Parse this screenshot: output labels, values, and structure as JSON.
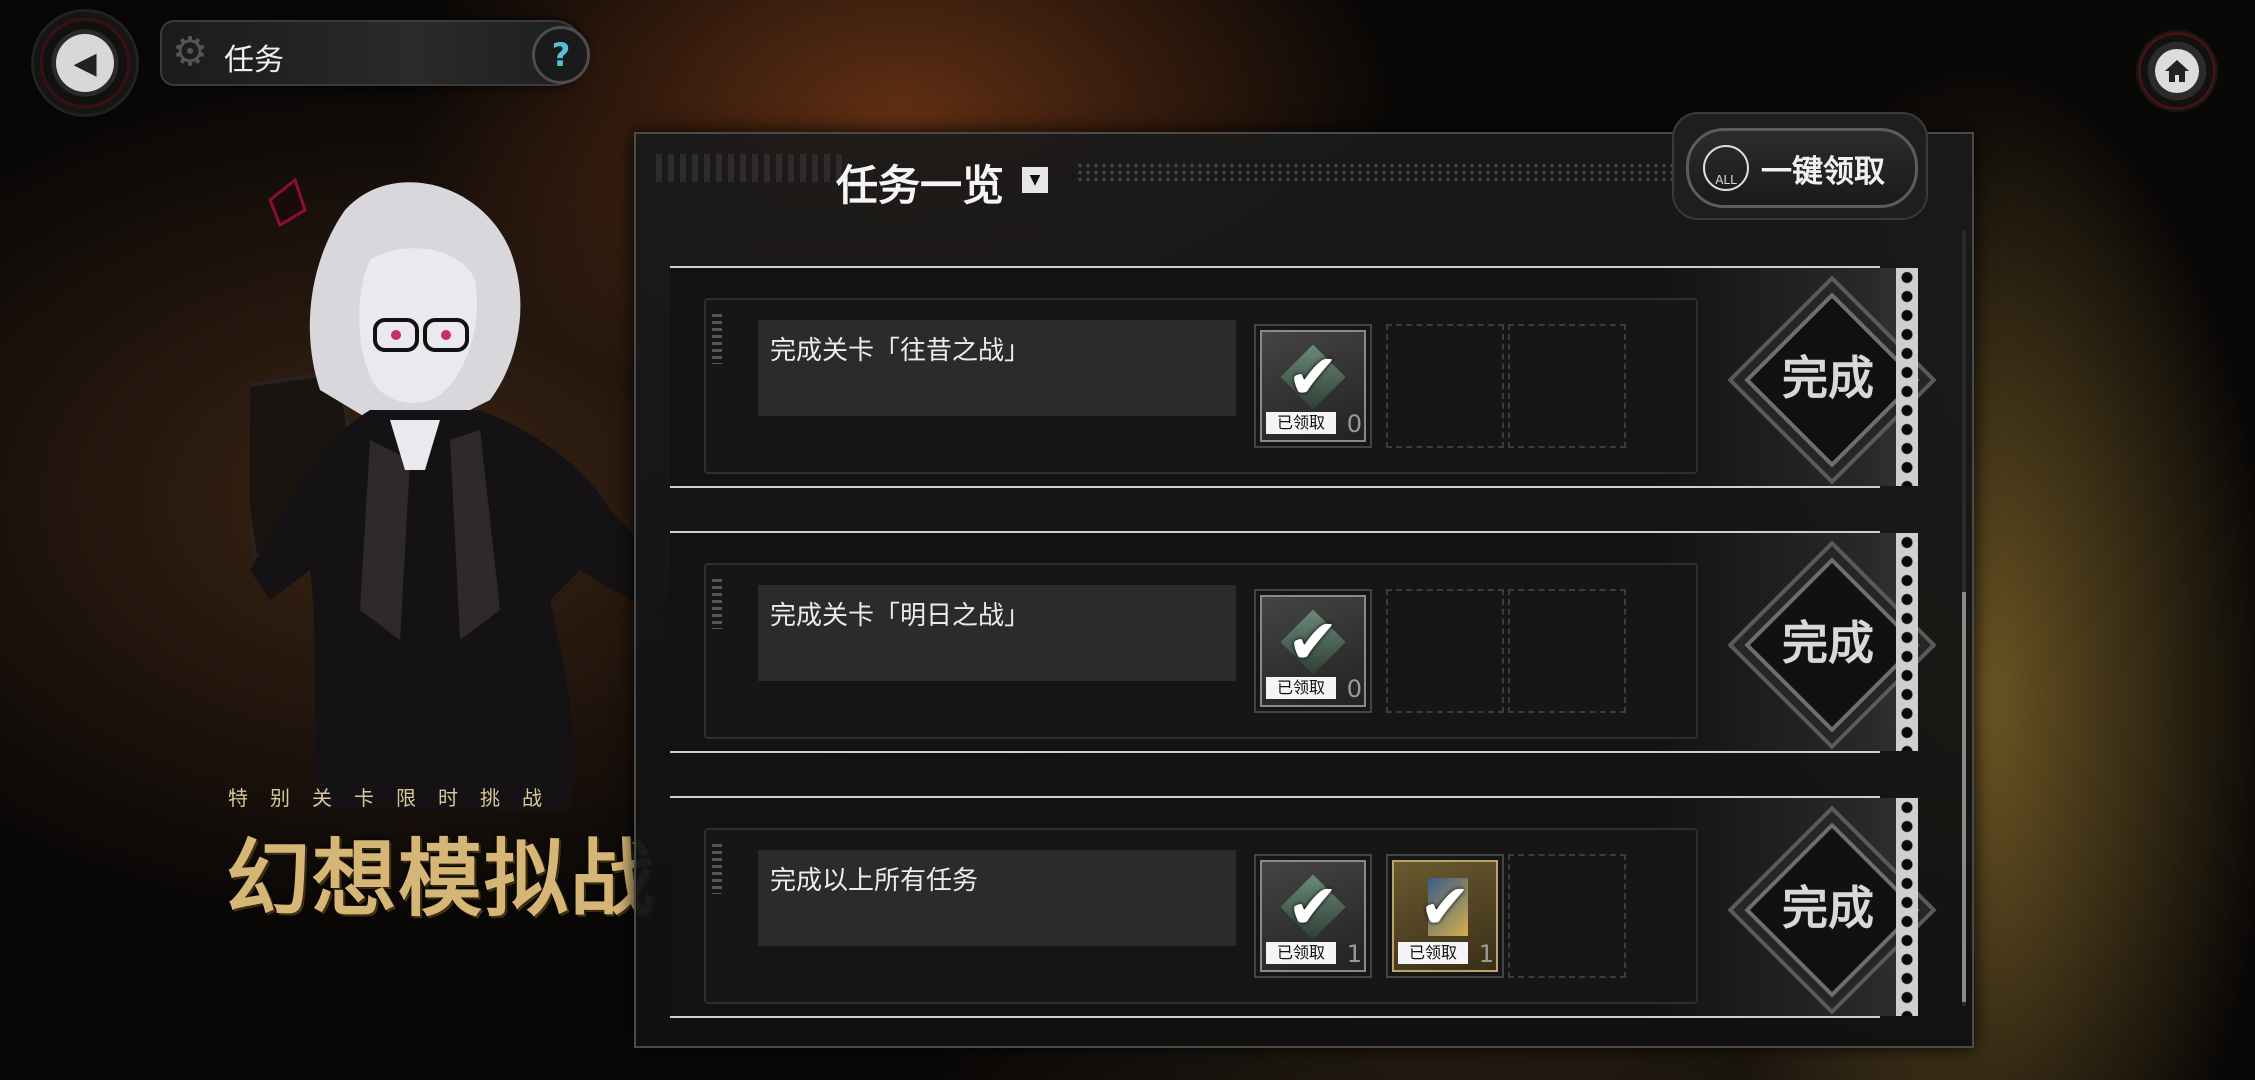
{
  "header": {
    "title": "任务",
    "help_label": "?"
  },
  "event": {
    "subtitle": "特别关卡限时挑战",
    "title": "幻想模拟战"
  },
  "panel": {
    "title": "任务一览",
    "claim_all_label": "一键领取",
    "claim_all_icon_text": "ALL"
  },
  "missions": [
    {
      "description": "完成关卡「往昔之战」",
      "status": "完成",
      "rewards": [
        {
          "claimed_label": "已领取",
          "qty": "0",
          "style": "grey"
        }
      ]
    },
    {
      "description": "完成关卡「明日之战」",
      "status": "完成",
      "rewards": [
        {
          "claimed_label": "已领取",
          "qty": "0",
          "style": "grey"
        }
      ]
    },
    {
      "description": "完成以上所有任务",
      "status": "完成",
      "rewards": [
        {
          "claimed_label": "已领取",
          "qty": "1",
          "style": "grey"
        },
        {
          "claimed_label": "已领取",
          "qty": "1",
          "style": "gold"
        }
      ]
    }
  ],
  "colors": {
    "accent_help": "#4fc3d8",
    "event_title": "#d5b676"
  }
}
